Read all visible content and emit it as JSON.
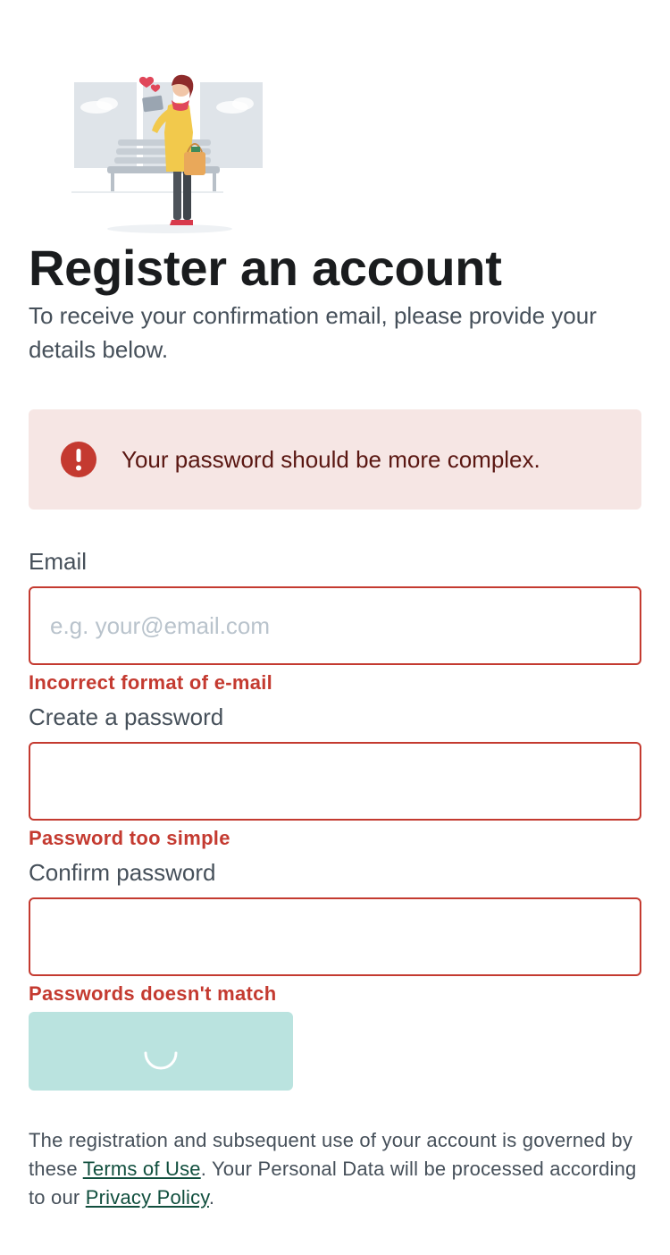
{
  "header": {
    "title": "Register an account",
    "subtitle": "To receive your confirmation email, please provide your details below."
  },
  "alert": {
    "icon": "exclamation-icon",
    "message": "Your password should be more complex.",
    "color": "#c43a30",
    "background": "#f6e6e4"
  },
  "form": {
    "email": {
      "label": "Email",
      "value": "",
      "placeholder": "e.g. your@email.com",
      "error": "Incorrect format of e-mail"
    },
    "password": {
      "label": "Create a password",
      "value": "",
      "placeholder": "",
      "error": "Password too simple"
    },
    "confirm_password": {
      "label": "Confirm password",
      "value": "",
      "placeholder": "",
      "error": "Passwords doesn't match"
    },
    "submit": {
      "state": "loading",
      "icon": "loading-spinner-icon",
      "color": "#bae3df"
    }
  },
  "legal": {
    "text_before_terms": "The registration and subsequent use of your account is governed by these ",
    "terms_link": "Terms of Use",
    "text_between": ". Your Personal Data will be processed according to our ",
    "privacy_link": "Privacy Policy",
    "text_after": "."
  },
  "colors": {
    "error": "#c43a30",
    "link": "#114f3e",
    "text": "#46505a"
  }
}
